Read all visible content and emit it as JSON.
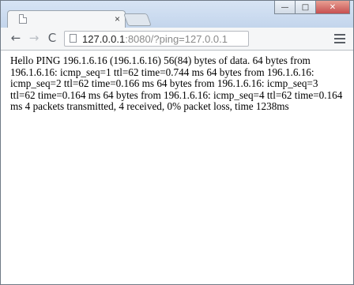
{
  "tab": {
    "close_glyph": "×"
  },
  "window_controls": {
    "minimize": "—",
    "maximize": "□",
    "close": "✕"
  },
  "toolbar": {
    "back_glyph": "←",
    "forward_glyph": "→",
    "reload_glyph": "C",
    "url_host": "127.0.0.1",
    "url_rest": ":8080/?ping=127.0.0.1"
  },
  "content": {
    "output": "Hello PING 196.1.6.16 (196.1.6.16) 56(84) bytes of data. 64 bytes from 196.1.6.16: icmp_seq=1 ttl=62 time=0.744 ms 64 bytes from 196.1.6.16: icmp_seq=2 ttl=62 time=0.166 ms 64 bytes from 196.1.6.16: icmp_seq=3 ttl=62 time=0.164 ms 64 bytes from 196.1.6.16: icmp_seq=4 ttl=62 time=0.164 ms 4 packets transmitted, 4 received, 0% packet loss, time 1238ms"
  },
  "icons": {
    "tab": "page-icon",
    "tab_close": "close-icon",
    "back": "back-arrow-icon",
    "forward": "forward-arrow-icon",
    "reload": "reload-icon",
    "omnibox": "page-icon",
    "menu": "hamburger-menu-icon"
  }
}
